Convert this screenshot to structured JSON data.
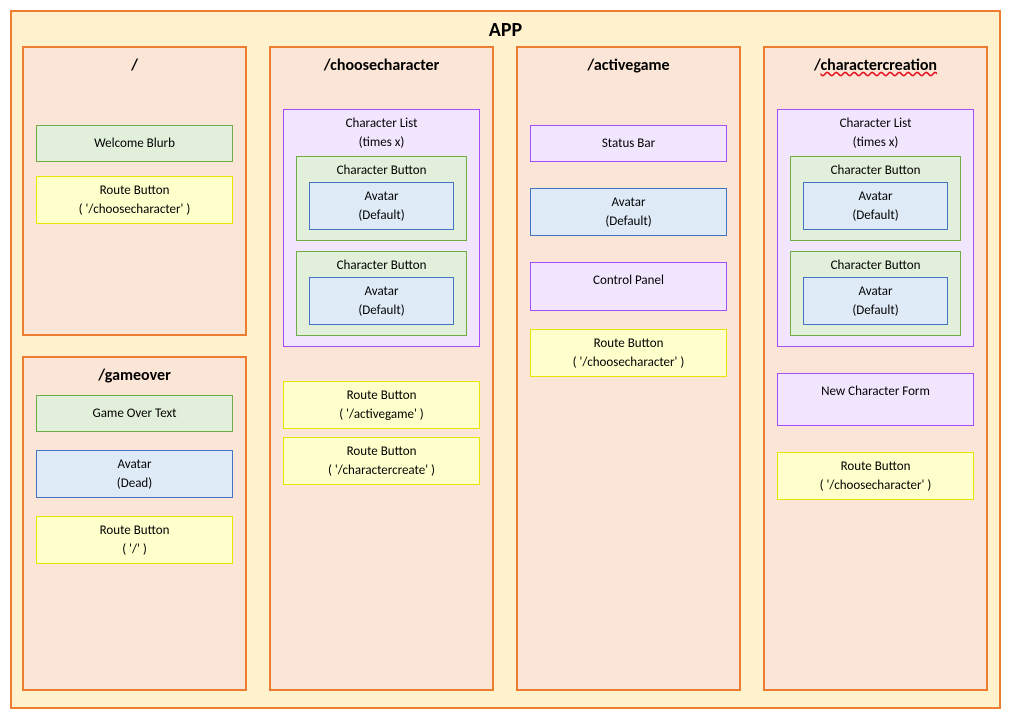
{
  "app_title": "APP",
  "routes": {
    "home": {
      "title": "/",
      "welcome": "Welcome Blurb",
      "route_button": {
        "l1": "Route Button",
        "l2": "( '/choosecharacter' )"
      }
    },
    "gameover": {
      "title": "/gameover",
      "game_over_text": "Game Over Text",
      "avatar": {
        "l1": "Avatar",
        "l2": "(Dead)"
      },
      "route_button": {
        "l1": "Route Button",
        "l2": "( '/' )"
      }
    },
    "choosecharacter": {
      "title": "/choosecharacter",
      "character_list": {
        "l1": "Character List",
        "l2": "(times x)"
      },
      "char_btn1": {
        "label": "Character Button",
        "avatar": {
          "l1": "Avatar",
          "l2": "(Default)"
        }
      },
      "char_btn2": {
        "label": "Character Button",
        "avatar": {
          "l1": "Avatar",
          "l2": "(Default)"
        }
      },
      "route_button1": {
        "l1": "Route Button",
        "l2": "( '/activegame' )"
      },
      "route_button2": {
        "l1": "Route Button",
        "l2": "( '/charactercreate' )"
      }
    },
    "activegame": {
      "title": "/activegame",
      "status_bar": "Status Bar",
      "avatar": {
        "l1": "Avatar",
        "l2": "(Default)"
      },
      "control_panel": "Control Panel",
      "route_button": {
        "l1": "Route Button",
        "l2": "( '/choosecharacter' )"
      }
    },
    "charactercreation": {
      "title_prefix": "/",
      "title_word": "charactercreation",
      "character_list": {
        "l1": "Character List",
        "l2": "(times x)"
      },
      "char_btn1": {
        "label": "Character Button",
        "avatar": {
          "l1": "Avatar",
          "l2": "(Default)"
        }
      },
      "char_btn2": {
        "label": "Character Button",
        "avatar": {
          "l1": "Avatar",
          "l2": "(Default)"
        }
      },
      "new_character_form": "New Character Form",
      "route_button": {
        "l1": "Route Button",
        "l2": "( '/choosecharacter' )"
      }
    }
  }
}
